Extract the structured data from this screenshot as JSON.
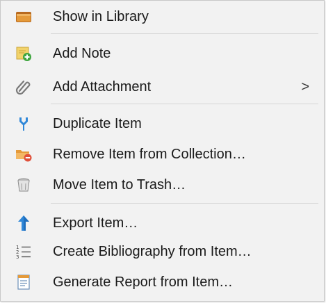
{
  "menu": {
    "items": [
      {
        "label": "Show in Library",
        "icon": "library-folder-icon"
      },
      {
        "label": "Add Note",
        "icon": "add-note-icon"
      },
      {
        "label": "Add Attachment",
        "icon": "paperclip-icon",
        "submenu_arrow": ">"
      },
      {
        "label": "Duplicate Item",
        "icon": "duplicate-icon"
      },
      {
        "label": "Remove Item from Collection…",
        "icon": "folder-remove-icon"
      },
      {
        "label": "Move Item to Trash…",
        "icon": "trash-icon"
      },
      {
        "label": "Export Item…",
        "icon": "export-arrow-icon"
      },
      {
        "label": "Create Bibliography from Item…",
        "icon": "numbered-list-icon"
      },
      {
        "label": "Generate Report from Item…",
        "icon": "report-icon"
      }
    ]
  },
  "colors": {
    "menu_background": "#f2f2f2",
    "separator": "#d6d6d6",
    "text": "#1a1a1a",
    "accent_blue": "#2f87d8",
    "folder_orange": "#e59a3a",
    "note_yellow": "#f2d36b",
    "remove_red": "#e0503a",
    "add_green": "#3ea53e"
  }
}
